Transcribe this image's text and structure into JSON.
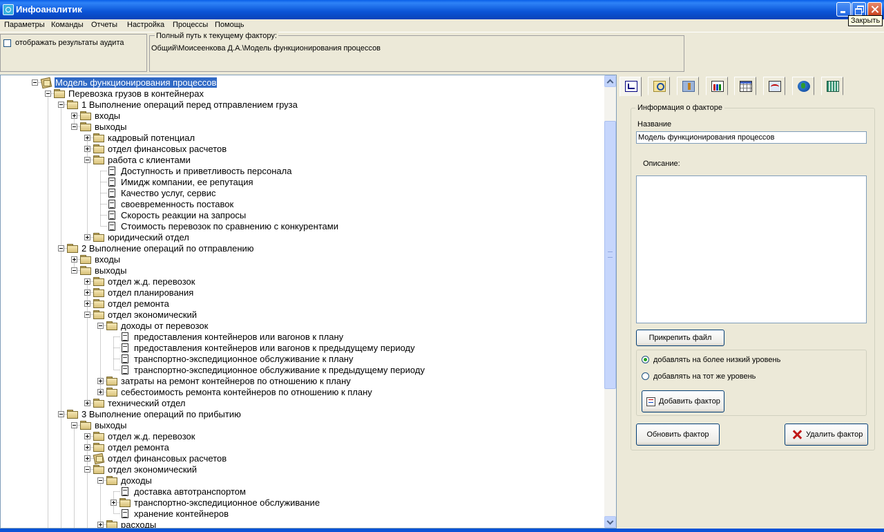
{
  "window": {
    "title": "Инфоаналитик",
    "tooltip": "Закрыть"
  },
  "menu": {
    "items": [
      "Параметры",
      "Команды",
      "Отчеты",
      "Настройка",
      "Процессы",
      "Помощь"
    ]
  },
  "audit": {
    "checkbox_label": "отображать результаты аудита",
    "checked": false
  },
  "path": {
    "legend": "Полный путь к текущему фактору:",
    "value": "Общий\\Моисеенкова Д.А.\\Модель функционирования процессов"
  },
  "tree": {
    "nodes": [
      {
        "label": "Модель функционирования процессов",
        "level": 0,
        "icon": "model-icon",
        "toggle": "minus",
        "selected": true
      },
      {
        "label": "Перевозка грузов в контейнерах",
        "level": 1,
        "icon": "folder-icon",
        "toggle": "minus"
      },
      {
        "label": "1 Выполнение операций перед отправлением груза",
        "level": 2,
        "icon": "folder-icon",
        "toggle": "minus"
      },
      {
        "label": "входы",
        "level": 3,
        "icon": "folder-icon",
        "toggle": "plus"
      },
      {
        "label": "выходы",
        "level": 3,
        "icon": "folder-icon",
        "toggle": "minus"
      },
      {
        "label": "кадровый потенциал",
        "level": 4,
        "icon": "folder-icon",
        "toggle": "plus"
      },
      {
        "label": "отдел финансовых расчетов",
        "level": 4,
        "icon": "folder-icon",
        "toggle": "plus"
      },
      {
        "label": "работа с клиентами",
        "level": 4,
        "icon": "folder-icon",
        "toggle": "minus"
      },
      {
        "label": "Доступность и приветливость персонала",
        "level": 5,
        "icon": "document-icon"
      },
      {
        "label": "Имидж компании, ее репутация",
        "level": 5,
        "icon": "document-icon"
      },
      {
        "label": "Качество услуг, сервис",
        "level": 5,
        "icon": "document-icon"
      },
      {
        "label": "своевременность поставок",
        "level": 5,
        "icon": "document-icon"
      },
      {
        "label": "Скорость реакции на запросы",
        "level": 5,
        "icon": "document-icon"
      },
      {
        "label": "Стоимость перевозок по сравнению с конкурентами",
        "level": 5,
        "icon": "document-icon"
      },
      {
        "label": "юридический отдел",
        "level": 4,
        "icon": "folder-icon",
        "toggle": "plus"
      },
      {
        "label": "2 Выполнение операций по отправлению",
        "level": 2,
        "icon": "folder-icon",
        "toggle": "minus"
      },
      {
        "label": "входы",
        "level": 3,
        "icon": "folder-icon",
        "toggle": "plus"
      },
      {
        "label": "выходы",
        "level": 3,
        "icon": "folder-icon",
        "toggle": "minus"
      },
      {
        "label": "отдел ж.д. перевозок",
        "level": 4,
        "icon": "folder-icon",
        "toggle": "plus"
      },
      {
        "label": "отдел планирования",
        "level": 4,
        "icon": "folder-icon",
        "toggle": "plus"
      },
      {
        "label": "отдел ремонта",
        "level": 4,
        "icon": "folder-icon",
        "toggle": "plus"
      },
      {
        "label": "отдел экономический",
        "level": 4,
        "icon": "folder-icon",
        "toggle": "minus"
      },
      {
        "label": "доходы от перевозок",
        "level": 5,
        "icon": "folder-icon",
        "toggle": "minus"
      },
      {
        "label": "предоставления контейнеров или вагонов к плану",
        "level": 6,
        "icon": "document-icon"
      },
      {
        "label": "предоставления контейнеров или вагонов к предыдущему периоду",
        "level": 6,
        "icon": "document-icon"
      },
      {
        "label": "транспортно-экспедиционное обслуживание к плану",
        "level": 6,
        "icon": "document-icon"
      },
      {
        "label": "транспортно-экспедиционное обслуживание к предыдущему периоду",
        "level": 6,
        "icon": "document-icon"
      },
      {
        "label": "затраты на ремонт контейнеров по отношению к плану",
        "level": 5,
        "icon": "folder-icon",
        "toggle": "plus"
      },
      {
        "label": "себестоимость ремонта контейнеров по отношению к плану",
        "level": 5,
        "icon": "folder-icon",
        "toggle": "plus"
      },
      {
        "label": "технический отдел",
        "level": 4,
        "icon": "folder-icon",
        "toggle": "plus"
      },
      {
        "label": "3 Выполнение операций по прибытию",
        "level": 2,
        "icon": "folder-icon",
        "toggle": "minus"
      },
      {
        "label": "выходы",
        "level": 3,
        "icon": "folder-icon",
        "toggle": "minus"
      },
      {
        "label": "отдел ж.д. перевозок",
        "level": 4,
        "icon": "folder-icon",
        "toggle": "plus"
      },
      {
        "label": "отдел ремонта",
        "level": 4,
        "icon": "folder-icon",
        "toggle": "plus"
      },
      {
        "label": "отдел финансовых расчетов",
        "level": 4,
        "icon": "model-icon",
        "toggle": "plus"
      },
      {
        "label": "отдел экономический",
        "level": 4,
        "icon": "folder-icon",
        "toggle": "minus"
      },
      {
        "label": "доходы",
        "level": 5,
        "icon": "folder-icon",
        "toggle": "minus"
      },
      {
        "label": "доставка автотранспортом",
        "level": 6,
        "icon": "document-icon"
      },
      {
        "label": "транспортно-экспедиционное обслуживание",
        "level": 6,
        "icon": "folder-icon",
        "toggle": "plus"
      },
      {
        "label": "хранение контейнеров",
        "level": 6,
        "icon": "document-icon"
      },
      {
        "label": "расходы",
        "level": 5,
        "icon": "folder-icon",
        "toggle": "plus"
      }
    ]
  },
  "toolbar": {
    "tabs": [
      {
        "icon": "tree-structure-icon",
        "active": true
      },
      {
        "icon": "search-factor-icon"
      },
      {
        "icon": "tools-icon"
      },
      {
        "icon": "bar-chart-icon"
      },
      {
        "icon": "table-icon"
      },
      {
        "icon": "line-graph-icon"
      },
      {
        "icon": "globe-icon"
      },
      {
        "icon": "calculator-icon"
      }
    ]
  },
  "factor_info": {
    "legend": "Информация о факторе",
    "name_label": "Название",
    "name_value": "Модель функционирования процессов",
    "description_label": "Описание:",
    "description_value": "",
    "attach_button": "Прикрепить файл",
    "radio_lower": "добавлять на более низкий уровень",
    "radio_same": "добавлять на тот же уровень",
    "radio_selected": "lower",
    "add_button": "Добавить фактор",
    "refresh_button": "Обновить фактор",
    "delete_button": "Удалить фактор"
  }
}
